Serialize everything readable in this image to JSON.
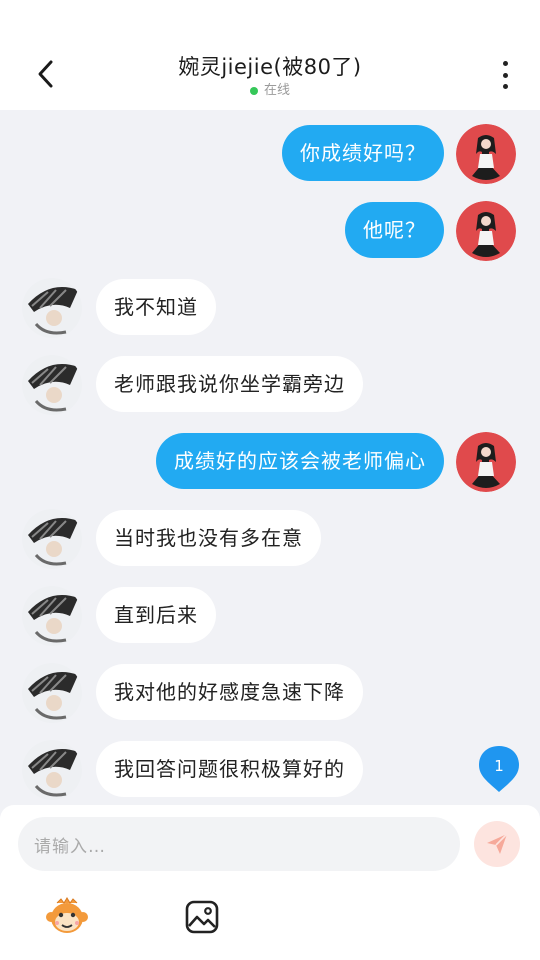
{
  "header": {
    "title": "婉灵jiejie(被80了)",
    "status": "在线",
    "status_color": "#35c759",
    "back_icon": "chevron-left-icon",
    "more_icon": "more-vertical-icon"
  },
  "messages": [
    {
      "from": "me",
      "text": "你成绩好吗？"
    },
    {
      "from": "me",
      "text": "他呢？"
    },
    {
      "from": "other",
      "text": "我不知道"
    },
    {
      "from": "other",
      "text": "老师跟我说你坐学霸旁边"
    },
    {
      "from": "me",
      "text": "成绩好的应该会被老师偏心"
    },
    {
      "from": "other",
      "text": "当时我也没有多在意"
    },
    {
      "from": "other",
      "text": "直到后来"
    },
    {
      "from": "other",
      "text": "我对他的好感度急速下降"
    },
    {
      "from": "other",
      "text": "我回答问题很积极算好的"
    }
  ],
  "colors": {
    "my_bubble": "#22aaf2",
    "other_bubble": "#ffffff",
    "badge": "#1f96f0"
  },
  "new_message_badge": {
    "count": "1"
  },
  "composer": {
    "placeholder": "请输入…",
    "send_icon": "send-icon",
    "emoji_icon": "monkey-emoji-icon",
    "image_icon": "image-icon"
  }
}
